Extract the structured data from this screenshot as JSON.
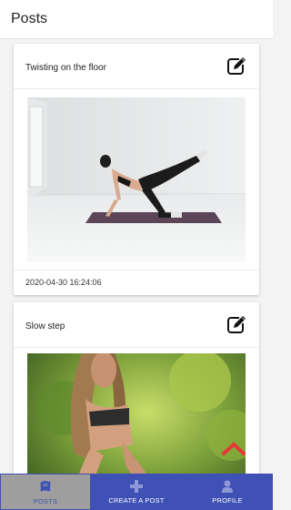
{
  "appbar": {
    "title": "Posts"
  },
  "posts": [
    {
      "title": "Twisting on the floor",
      "timestamp": "2020-04-30 16:24:06",
      "image_subject": "woman doing a kneeling leg-lift exercise on a purple mat in a white room",
      "edit_icon": "edit-icon"
    },
    {
      "title": "Slow step",
      "image_subject": "woman in a crouched sprint-start position on an outdoor path",
      "edit_icon": "edit-icon"
    }
  ],
  "scroll_top": {
    "icon": "chevron-up-icon",
    "color": "#e53935"
  },
  "bottom_nav": {
    "color": "#3f51b5",
    "active_color": "#9e9e9e",
    "items": [
      {
        "label": "POSTS",
        "icon": "book-icon",
        "active": true
      },
      {
        "label": "CREATE A POST",
        "icon": "plus-icon",
        "active": false
      },
      {
        "label": "PROFILE",
        "icon": "user-icon",
        "active": false
      }
    ]
  }
}
